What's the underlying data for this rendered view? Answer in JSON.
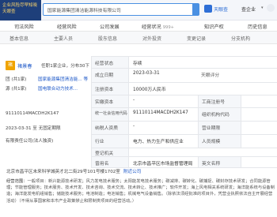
{
  "ad": {
    "line1": "企业风险尽早知晓",
    "line2": "天眼查"
  },
  "search": {
    "value": "国家能源集团清洁能源科技有限公司"
  },
  "header": {
    "brand": "天眼查",
    "menu_item": "查企业"
  },
  "tabs": [
    {
      "label": "司法风险",
      "count": ""
    },
    {
      "label": "经营风险",
      "count": ""
    },
    {
      "label": "公司发展",
      "count": ""
    },
    {
      "label": "经营状况",
      "count": "999+"
    },
    {
      "label": "知识产权",
      "count": ""
    },
    {
      "label": "历史信息",
      "count": ""
    }
  ],
  "subtabs": [
    "基本信息",
    "主要人员",
    "股东信息",
    "对外投资",
    "变更记录",
    "分支机构"
  ],
  "person": {
    "avatar_char": "褚",
    "name": "褚景春",
    "role_note": "任职1家企业，分布30下",
    "line_a": "团 (共1家)",
    "line_b": "国家能源集团清洁能... 等",
    "line_c": "源 (共1家)",
    "line_d": "国电联合动力技术...",
    "credit_code": "91110114MACDH2K147",
    "date_line": "2023-03-31  至  无固定期限",
    "legal_type": "有限责任公司(法人独资)"
  },
  "table": {
    "rows": [
      {
        "label": "经营状态",
        "value": "存续",
        "label2": "",
        "value2": ""
      },
      {
        "label": "成立日期",
        "value": "2023-03-31",
        "label2": "天眼评分",
        "value2": ""
      },
      {
        "label": "注册资本",
        "value": "10000万人民币",
        "label2": "",
        "value2": ""
      },
      {
        "label": "实缴资本",
        "value": "-",
        "label2": "工商注册号",
        "value2": ""
      },
      {
        "label": "统一社会信用代码",
        "value": "91110114MACDH2K147",
        "label2": "组织机构代码",
        "value2": ""
      },
      {
        "label": "纳税人资质",
        "value": "-",
        "label2": "营业期限",
        "value2": ""
      },
      {
        "label": "行业",
        "value": "电力、热力生产和供应业",
        "label2": "人员规模",
        "value2": ""
      },
      {
        "label": "登记机关",
        "value": "",
        "label2": "",
        "value2": ""
      },
      {
        "label": "曾用名",
        "value": "北京市昌平区市场监督管理局",
        "label2": "英文名称",
        "value2": ""
      }
    ]
  },
  "address": {
    "text": "北京市昌平区未来科学城英才北二街29号101号楼1702室",
    "link": "附近公司"
  },
  "scope": {
    "label": "经营范围：",
    "text": "一般项目：新兴能源技术研发；风力发电技术服务；太阳能发电技术服务；碳减排、碳转化、碳捕捉、碳封存技术研发；合同能源管理；节能管理服务；技术服务、技术开发、技术咨询、技术交流、技术转让、技术推广；软件开发；海上风电相关系统研发；海洋能系统与设备制造；海洋能发电机组销售；储能技术服务；电池制造；电池销售；机械电气设备销售。（除依法须经批准的项目外，凭营业执照依法自主开展经营活动）（不得从事国家和本市产业政策禁止和限制类项目的经营活动。）"
  }
}
